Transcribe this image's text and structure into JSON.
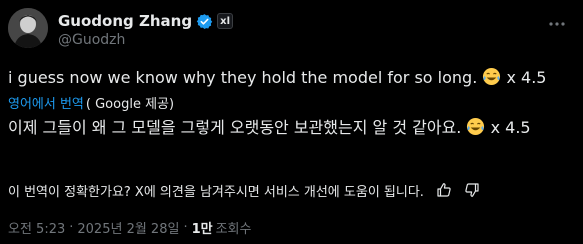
{
  "author": {
    "name": "Guodong Zhang",
    "handle": "@Guodzh",
    "affiliate_badge": "xl",
    "avatar_icon": "person-photo-avatar",
    "verified_color": "#1d9bf0"
  },
  "icons": {
    "more": "more-dots-icon",
    "verified": "verified-badge-icon",
    "emoji": "laughing-tears-emoji",
    "thumbs_up": "thumbs-up-icon",
    "thumbs_down": "thumbs-down-icon"
  },
  "tweet": {
    "text": "i guess now we know why they hold the model for so long.",
    "text_suffix": " x 4.5"
  },
  "translation": {
    "link_label": "영어에서 번역",
    "source_label": "( Google 제공)",
    "text": "이제 그들이 왜 그 모델을 그렇게 오랫동안 보관했는지 알 것 같아요.",
    "text_suffix": " x 4.5"
  },
  "feedback": {
    "question": "이 번역이 정확한가요? X에 의견을 남겨주시면 서비스 개선에 도움이 됩니다."
  },
  "meta": {
    "time": "오전 5:23",
    "dot1": "·",
    "date": "2025년 2월 28일",
    "dot2": "·",
    "views_count": "1만",
    "views_label": "조회수"
  },
  "colors": {
    "background": "#000000",
    "text": "#e7e9ea",
    "secondary": "#71767b",
    "link": "#1d9bf0"
  }
}
